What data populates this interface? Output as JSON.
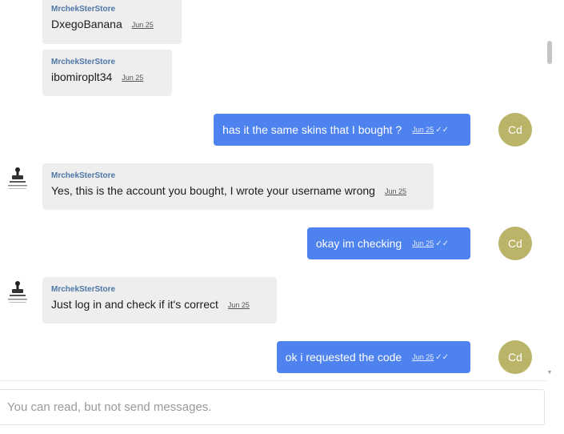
{
  "colors": {
    "outgoing_bubble": "#4d82ef",
    "incoming_bubble": "#eeeeef",
    "sender_name": "#4e76a6",
    "avatar": "#b9b468"
  },
  "messages": [
    {
      "direction": "incoming",
      "sender": "MrchekSterStore",
      "text": "DxegoBanana",
      "time": "Jun 25"
    },
    {
      "direction": "incoming",
      "sender": "MrchekSterStore",
      "text": "ibomiroplt34",
      "time": "Jun 25"
    },
    {
      "direction": "outgoing",
      "text": "has it the same skins that I bought ?",
      "time": "Jun 25",
      "avatar": "Cd",
      "read_icon": "double-check-icon"
    },
    {
      "direction": "incoming",
      "sender": "MrchekSterStore",
      "text": "Yes, this is the account you bought, I wrote your username wrong",
      "time": "Jun 25",
      "avatar_icon": "store-logo-icon"
    },
    {
      "direction": "outgoing",
      "text": "okay im checking",
      "time": "Jun 25",
      "avatar": "Cd",
      "read_icon": "double-check-icon"
    },
    {
      "direction": "incoming",
      "sender": "MrchekSterStore",
      "text": "Just log in and check if it's correct",
      "time": "Jun 25",
      "avatar_icon": "store-logo-icon"
    },
    {
      "direction": "outgoing",
      "text": "ok i requested the code",
      "time": "Jun 25",
      "avatar": "Cd",
      "read_icon": "double-check-icon"
    }
  ],
  "composer": {
    "notice": "You can read, but not send messages."
  }
}
